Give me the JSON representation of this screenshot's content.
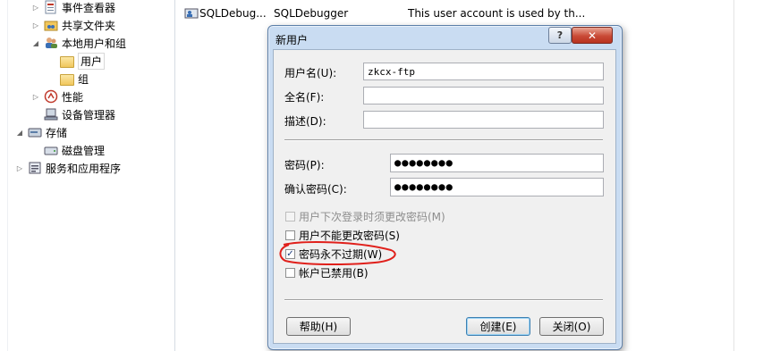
{
  "tree": {
    "items": [
      {
        "label": "事件查看器",
        "icon": "event-viewer-icon"
      },
      {
        "label": "共享文件夹",
        "icon": "shared-folders-icon"
      },
      {
        "label": "本地用户和组",
        "icon": "local-users-groups-icon"
      },
      {
        "label": "用户",
        "icon": "folder-icon"
      },
      {
        "label": "组",
        "icon": "folder-icon"
      },
      {
        "label": "性能",
        "icon": "performance-icon"
      },
      {
        "label": "设备管理器",
        "icon": "device-manager-icon"
      },
      {
        "label": "存储",
        "icon": "storage-icon"
      },
      {
        "label": "磁盘管理",
        "icon": "disk-management-icon"
      },
      {
        "label": "服务和应用程序",
        "icon": "services-apps-icon"
      }
    ]
  },
  "list": {
    "row": {
      "name": "SQLDebug...",
      "full_name": "SQLDebugger",
      "description": "This user account is used by th..."
    }
  },
  "dialog": {
    "title": "新用户",
    "help_glyph": "?",
    "close_glyph": "✕",
    "fields": {
      "username_label": "用户名(U):",
      "username_value": "zkcx-ftp",
      "fullname_label": "全名(F):",
      "fullname_value": "",
      "description_label": "描述(D):",
      "description_value": "",
      "password_label": "密码(P):",
      "password_value": "●●●●●●●●",
      "confirm_label": "确认密码(C):",
      "confirm_value": "●●●●●●●●"
    },
    "checkboxes": [
      {
        "label": "用户下次登录时须更改密码(M)",
        "checked": false,
        "disabled": true
      },
      {
        "label": "用户不能更改密码(S)",
        "checked": false,
        "disabled": false
      },
      {
        "label": "密码永不过期(W)",
        "checked": true,
        "disabled": false
      },
      {
        "label": "帐户已禁用(B)",
        "checked": false,
        "disabled": false
      }
    ],
    "buttons": {
      "help": "帮助(H)",
      "create": "创建(E)",
      "close": "关闭(O)"
    }
  },
  "colors": {
    "dialog_frame": "#c9dcf2",
    "annotation": "#e0201b"
  }
}
